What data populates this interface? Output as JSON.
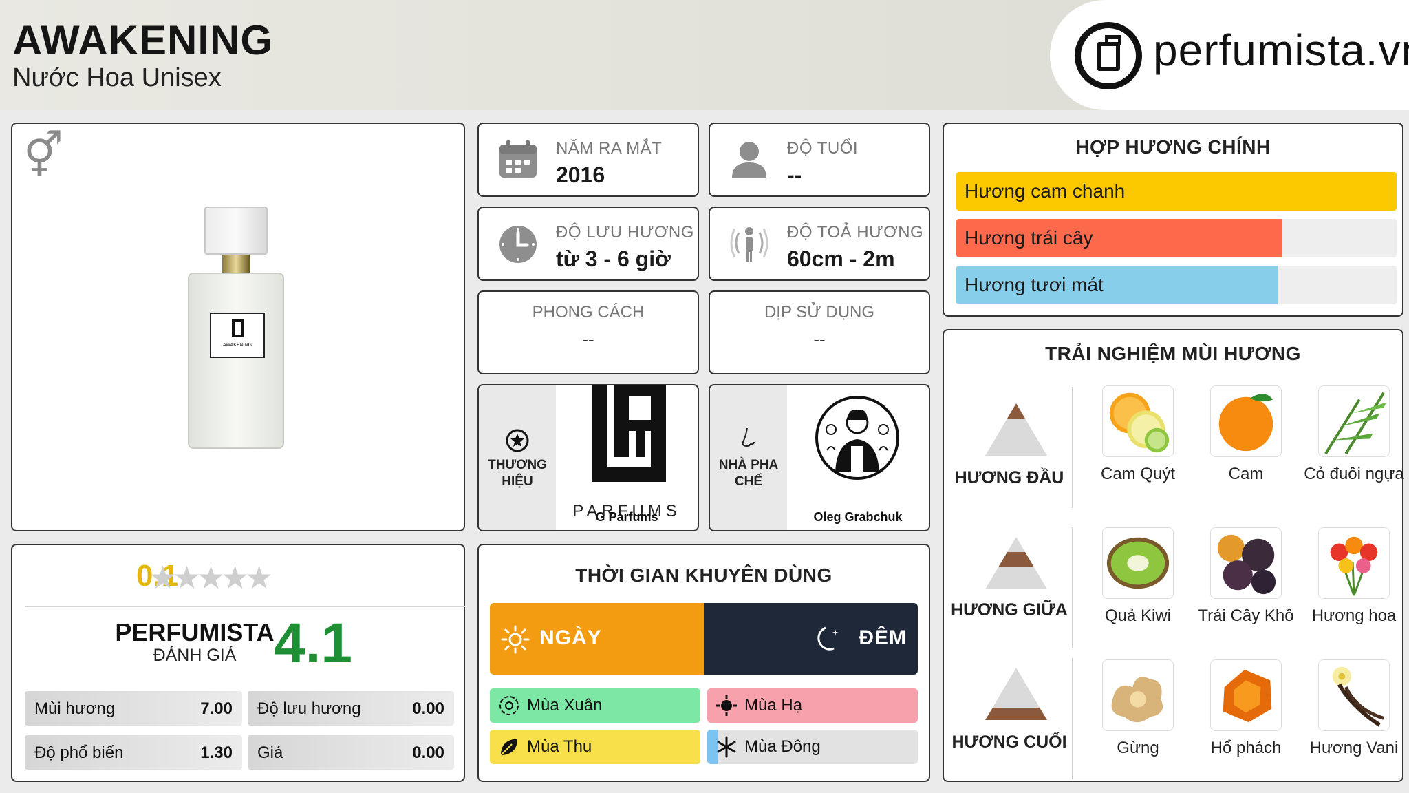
{
  "header": {
    "title": "AWAKENING",
    "subtitle": "Nước Hoa Unisex",
    "logo_text": "perfumista.vn"
  },
  "product": {
    "gender_icon": "unisex-icon",
    "label_text": "AWAKENING"
  },
  "info": {
    "year_label": "NĂM RA MẮT",
    "year_value": "2016",
    "age_label": "ĐỘ TUỔI",
    "age_value": "--",
    "longevity_label": "ĐỘ LƯU HƯƠNG",
    "longevity_value": "từ 3 - 6 giờ",
    "sillage_label": "ĐỘ TOẢ HƯƠNG",
    "sillage_value": "60cm - 2m",
    "style_label": "PHONG CÁCH",
    "style_value": "--",
    "occasion_label": "DỊP SỬ DỤNG",
    "occasion_value": "--",
    "brand_label": "THƯƠNG HIỆU",
    "brand_name": "G Parfums",
    "brand_logo_text": "PARFUMS",
    "perfumer_label": "NHÀ PHA CHẾ",
    "perfumer_name": "Oleg Grabchuk"
  },
  "rating": {
    "user_score": "0.1",
    "stars": 5,
    "pf_label": "PERFUMISTA",
    "pf_sub": "ĐÁNH GIÁ",
    "pf_score": "4.1",
    "metrics": [
      {
        "label": "Mùi hương",
        "value": "7.00"
      },
      {
        "label": "Độ lưu hương",
        "value": "0.00"
      },
      {
        "label": "Độ phổ biến",
        "value": "1.30"
      },
      {
        "label": "Giá",
        "value": "0.00"
      }
    ]
  },
  "time": {
    "title": "THỜI GIAN KHUYÊN DÙNG",
    "day": "NGÀY",
    "night": "ĐÊM",
    "day_share": 0.5,
    "seasons": [
      {
        "label": "Mùa Xuân",
        "color": "#7de8a6",
        "level": 1.0,
        "icon": "flower-icon"
      },
      {
        "label": "Mùa Hạ",
        "color": "#f7a1ad",
        "level": 1.0,
        "icon": "sun-icon"
      },
      {
        "label": "Mùa Thu",
        "color": "#f8e04a",
        "level": 1.0,
        "icon": "leaf-icon"
      },
      {
        "label": "Mùa Đông",
        "color": "#7ec3ef",
        "level": 0.05,
        "icon": "snowflake-icon"
      }
    ]
  },
  "accords": {
    "title": "HỢP HƯƠNG CHÍNH",
    "items": [
      {
        "label": "Hương cam chanh",
        "color": "#fcc800",
        "level": 1.0
      },
      {
        "label": "Hương trái cây",
        "color": "#fd6a4b",
        "level": 0.74
      },
      {
        "label": "Hương tươi mát",
        "color": "#87ceeb",
        "level": 0.73
      }
    ]
  },
  "notes": {
    "title": "TRẢI NGHIỆM MÙI HƯƠNG",
    "rows": [
      {
        "label": "HƯƠNG ĐẦU",
        "items": [
          "Cam Quýt",
          "Cam",
          "Cỏ đuôi ngựa"
        ]
      },
      {
        "label": "HƯƠNG GIỮA",
        "items": [
          "Quả Kiwi",
          "Trái Cây Khô",
          "Hương hoa"
        ]
      },
      {
        "label": "HƯƠNG CUỐI",
        "items": [
          "Gừng",
          "Hổ phách",
          "Hương Vani"
        ]
      }
    ]
  },
  "colors": {
    "rating_yellow": "#e6b80f",
    "pf_green": "#1f8f35",
    "day": "#f39c12",
    "night": "#1e2838"
  }
}
